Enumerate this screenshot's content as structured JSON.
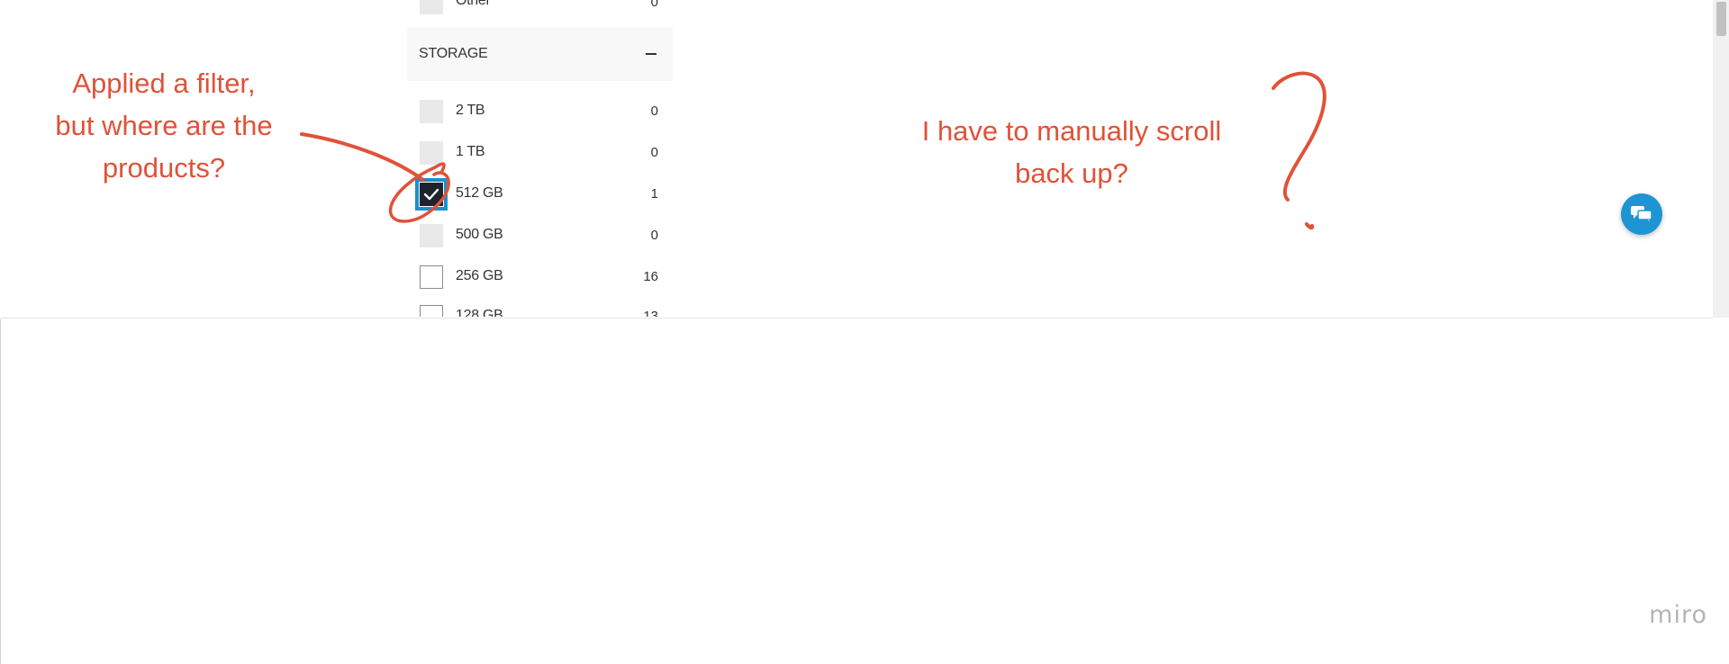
{
  "filter_panel": {
    "previous_option": {
      "label": "Other",
      "count": "0"
    },
    "section": {
      "title": "STORAGE",
      "collapse_symbol": "–"
    },
    "options": [
      {
        "label": "2 TB",
        "count": "0",
        "state": "disabled"
      },
      {
        "label": "1 TB",
        "count": "0",
        "state": "disabled"
      },
      {
        "label": "512 GB",
        "count": "1",
        "state": "checked"
      },
      {
        "label": "500 GB",
        "count": "0",
        "state": "disabled"
      },
      {
        "label": "256 GB",
        "count": "16",
        "state": "unchecked"
      },
      {
        "label": "128 GB",
        "count": "13",
        "state": "unchecked"
      }
    ]
  },
  "annotations": {
    "left": [
      "Applied a filter,",
      "but where are the",
      "products?"
    ],
    "right": [
      "I have to manually scroll",
      "back up?"
    ]
  },
  "chat_button": {
    "icon": "chat-bubbles-icon"
  },
  "board": {
    "logo": "miro"
  },
  "colors": {
    "annotation": "#e05238",
    "checkbox_checked": "#1f232b",
    "focus_outline": "#1b8fce",
    "chat_button": "#1d95d3",
    "section_header_bg": "#f8f8f8",
    "disabled_checkbox": "#e9e9e9"
  }
}
